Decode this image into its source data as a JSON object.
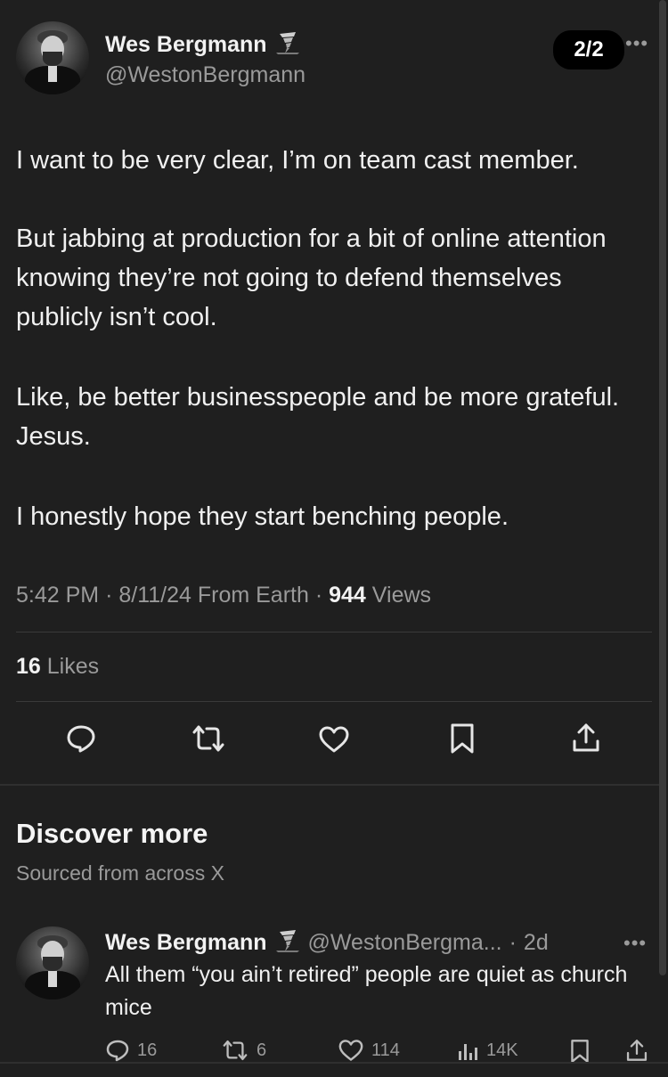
{
  "tweet": {
    "author_name": "Wes Bergmann",
    "author_handle": "@WestonBergmann",
    "author_badge_icon": "tornado-icon",
    "thread_counter": "2/2",
    "more_icon": "more-dots-icon",
    "paragraphs": [
      "I want to be very clear, I’m on team cast member.",
      "But jabbing at production for a bit of online attention knowing they’re not going to defend themselves publicly isn’t cool.",
      "Like, be better businesspeople and be more grateful. Jesus.",
      "I honestly hope they start benching people."
    ],
    "meta": {
      "time": "5:42 PM",
      "sep1": "·",
      "date": "8/11/24",
      "source": "From Earth",
      "sep2": "·",
      "views_count": "944",
      "views_label": "Views"
    },
    "likes": {
      "count": "16",
      "label": "Likes"
    },
    "actions": [
      "reply-icon",
      "retweet-icon",
      "like-icon",
      "bookmark-icon",
      "share-icon"
    ]
  },
  "discover": {
    "title": "Discover more",
    "subtitle": "Sourced from across X"
  },
  "suggested": {
    "author_name": "Wes Bergmann",
    "author_handle": "@WestonBergma...",
    "sep": "·",
    "age": "2d",
    "text": "All them “you ain’t retired” people are quiet as church mice",
    "replies": "16",
    "retweets": "6",
    "likes": "114",
    "views": "14K"
  },
  "colors": {
    "background": "#1f1f1f",
    "text": "#f0f0f0",
    "secondary": "#9a9a9a",
    "pill": "#000000"
  }
}
